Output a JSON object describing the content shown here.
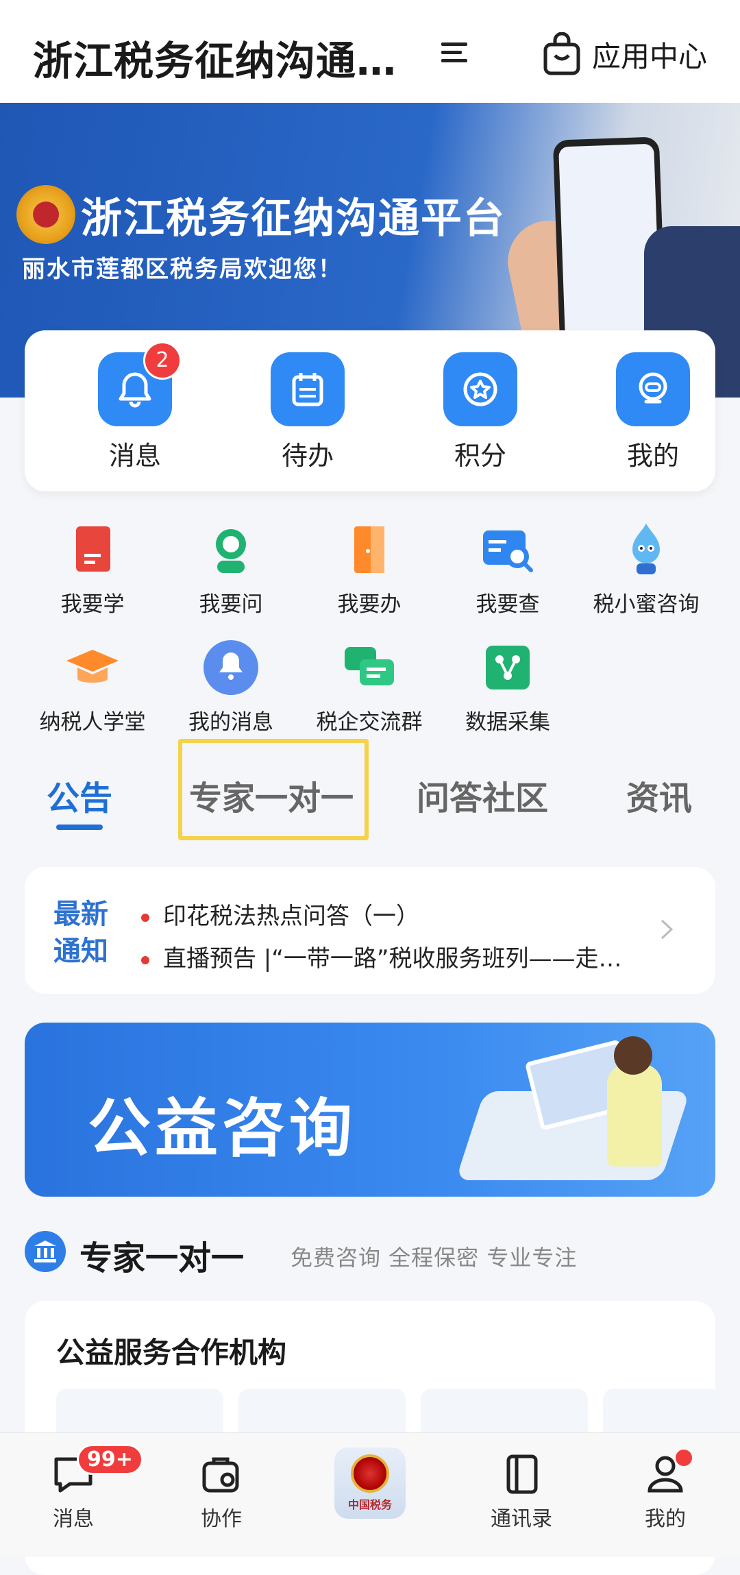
{
  "header": {
    "title": "浙江税务征纳沟通…",
    "app_center_label": "应用中心"
  },
  "banner": {
    "title": "浙江税务征纳沟通平台",
    "subtitle": "丽水市莲都区税务局欢迎您！"
  },
  "quick_actions": [
    {
      "label": "消息",
      "icon": "bell-icon",
      "badge": "2"
    },
    {
      "label": "待办",
      "icon": "calendar-icon"
    },
    {
      "label": "积分",
      "icon": "star-icon"
    },
    {
      "label": "我的",
      "icon": "robot-face-icon"
    }
  ],
  "grid": [
    {
      "label": "我要学",
      "icon": "book-icon"
    },
    {
      "label": "我要问",
      "icon": "headset-icon"
    },
    {
      "label": "我要办",
      "icon": "door-icon"
    },
    {
      "label": "我要查",
      "icon": "search-card-icon"
    },
    {
      "label": "税小蜜咨询",
      "icon": "mascot-icon"
    },
    {
      "label": "纳税人学堂",
      "icon": "graduation-cap-icon"
    },
    {
      "label": "我的消息",
      "icon": "bell-circle-icon"
    },
    {
      "label": "税企交流群",
      "icon": "chat-group-icon"
    },
    {
      "label": "数据采集",
      "icon": "data-collect-icon"
    }
  ],
  "tabs": [
    {
      "label": "公告",
      "active": true
    },
    {
      "label": "专家一对一",
      "active": false
    },
    {
      "label": "问答社区",
      "active": false
    },
    {
      "label": "资讯",
      "active": false
    }
  ],
  "notice": {
    "tag_line1": "最新",
    "tag_line2": "通知",
    "items": [
      "印花税法热点问答（一）",
      "直播预告 |“一带一路”税收服务班列——走…"
    ]
  },
  "promo": {
    "title": "公益咨询"
  },
  "expert_section": {
    "title": "专家一对一",
    "subtitle": "免费咨询 全程保密 专业专注",
    "card_title": "公益服务合作机构"
  },
  "bottom_nav": [
    {
      "label": "消息",
      "icon": "message-icon",
      "badge": "99+"
    },
    {
      "label": "协作",
      "icon": "collaboration-icon"
    },
    {
      "label": "",
      "icon": "tax-emblem-icon",
      "logo_text": "中国税务"
    },
    {
      "label": "通讯录",
      "icon": "contacts-icon"
    },
    {
      "label": "我的",
      "icon": "user-icon",
      "dot": true
    }
  ],
  "colors": {
    "primary": "#2f8af5",
    "tab_active": "#1f6fd6",
    "badge": "#f03c3c",
    "highlight": "#f5d24a"
  }
}
